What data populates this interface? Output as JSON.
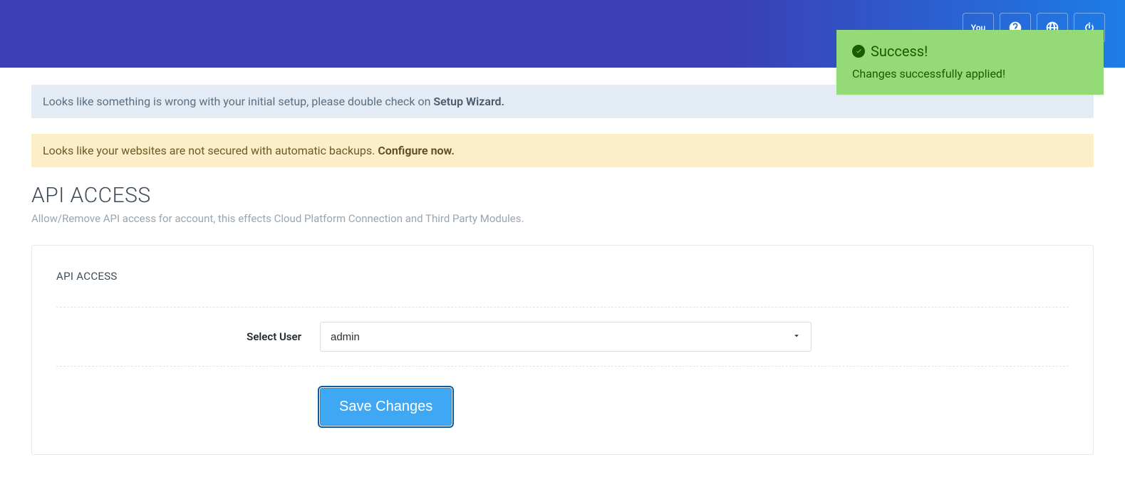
{
  "toast": {
    "title": "Success!",
    "message": "Changes successfully applied!"
  },
  "alerts": {
    "setup_text": "Looks like something is wrong with your initial setup, please double check on ",
    "setup_link": "Setup Wizard.",
    "backup_text": "Looks like your websites are not secured with automatic backups. ",
    "backup_link": "Configure now."
  },
  "page": {
    "title": "API ACCESS",
    "subtitle": "Allow/Remove API access for account, this effects Cloud Platform Connection and Third Party Modules."
  },
  "panel": {
    "title": "API ACCESS",
    "select_user_label": "Select User",
    "selected_user": "admin",
    "save_label": "Save Changes"
  },
  "header_icons": {
    "youtube": "You",
    "help": "help",
    "globe": "globe",
    "power": "power"
  }
}
